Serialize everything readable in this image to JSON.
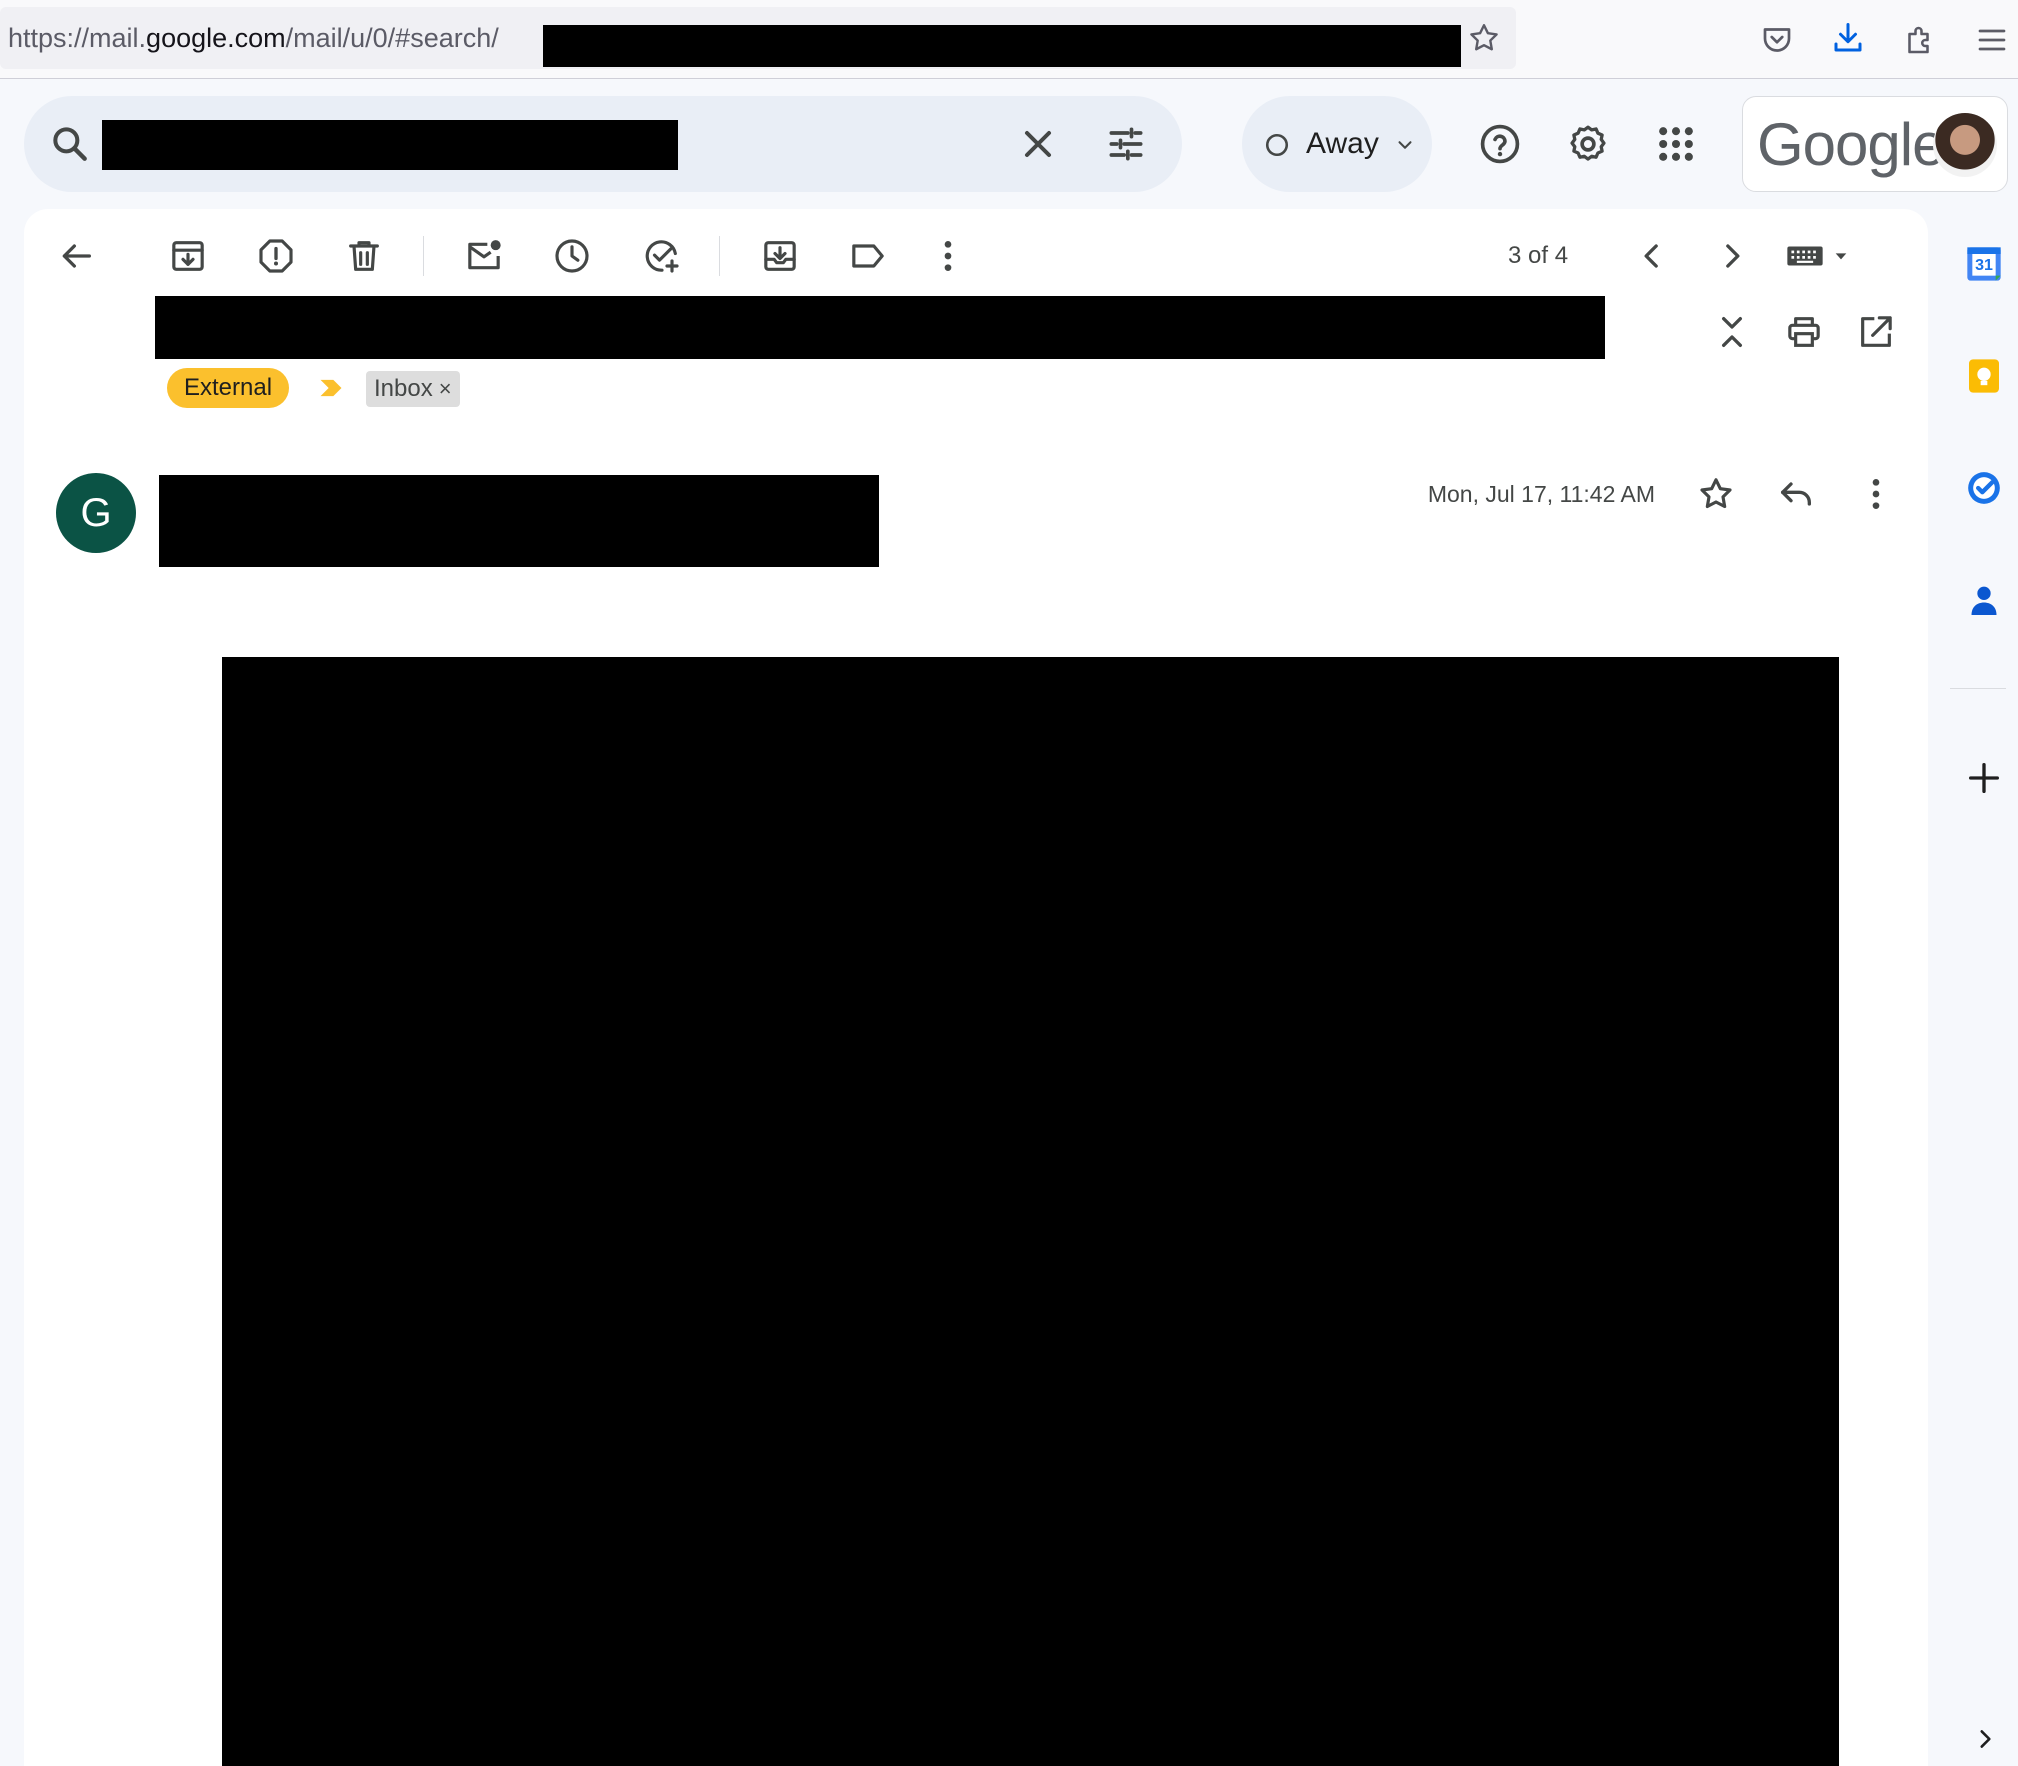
{
  "browser": {
    "url_prefix": "https://mail.",
    "url_domain": "google.com",
    "url_path": "/mail/u/0/#search/"
  },
  "header": {
    "status_label": "Away",
    "google_wordmark": "Google"
  },
  "toolbar": {
    "pager": "3 of 4"
  },
  "labels": {
    "external": "External",
    "inbox": "Inbox",
    "inbox_remove": "×"
  },
  "message": {
    "avatar_letter": "G",
    "date": "Mon, Jul 17, 11:42 AM"
  },
  "side_panel": {
    "calendar_day": "31"
  },
  "icons": {
    "toolbar": [
      "back-arrow-icon",
      "archive-icon",
      "report-spam-icon",
      "delete-icon",
      "mark-unread-icon",
      "snooze-icon",
      "add-task-icon",
      "move-to-icon",
      "label-icon",
      "more-vert-icon"
    ],
    "header": [
      "search-icon",
      "clear-icon",
      "search-options-icon",
      "help-icon",
      "settings-icon",
      "apps-icon"
    ]
  },
  "colors": {
    "page_bg": "#f6f8fc",
    "search_bg": "#e9eef6",
    "external_label": "#fbc02d",
    "avatar_bg": "#0b5345",
    "calendar_blue": "#4285f4",
    "keep_yellow": "#fbbc04",
    "tasks_blue": "#1a73e8",
    "contacts_blue": "#0b57d0"
  }
}
